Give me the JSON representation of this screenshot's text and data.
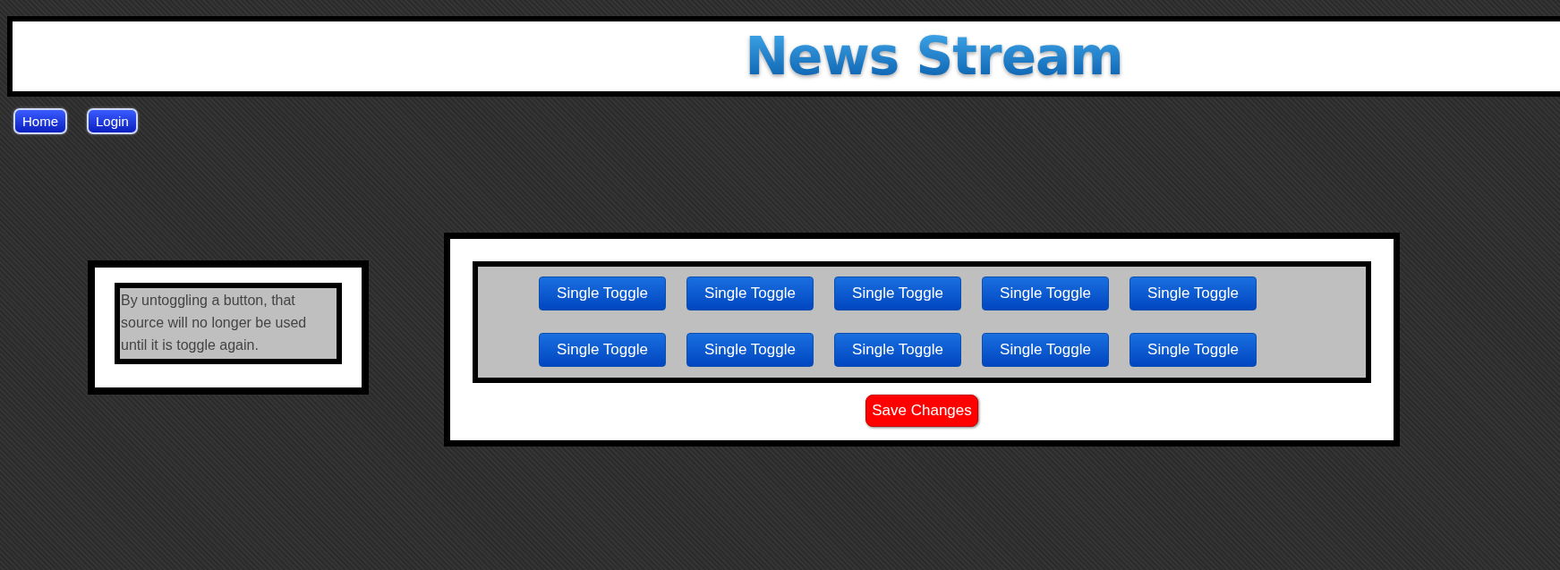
{
  "header": {
    "title": "News Stream"
  },
  "nav": [
    {
      "label": "Home"
    },
    {
      "label": "Login"
    }
  ],
  "info": {
    "text": "By untoggling a button, that source will no longer be used until it is toggle again."
  },
  "toggles": [
    {
      "label": "Single Toggle"
    },
    {
      "label": "Single Toggle"
    },
    {
      "label": "Single Toggle"
    },
    {
      "label": "Single Toggle"
    },
    {
      "label": "Single Toggle"
    },
    {
      "label": "Single Toggle"
    },
    {
      "label": "Single Toggle"
    },
    {
      "label": "Single Toggle"
    },
    {
      "label": "Single Toggle"
    },
    {
      "label": "Single Toggle"
    }
  ],
  "save_button": {
    "label": "Save Changes"
  }
}
